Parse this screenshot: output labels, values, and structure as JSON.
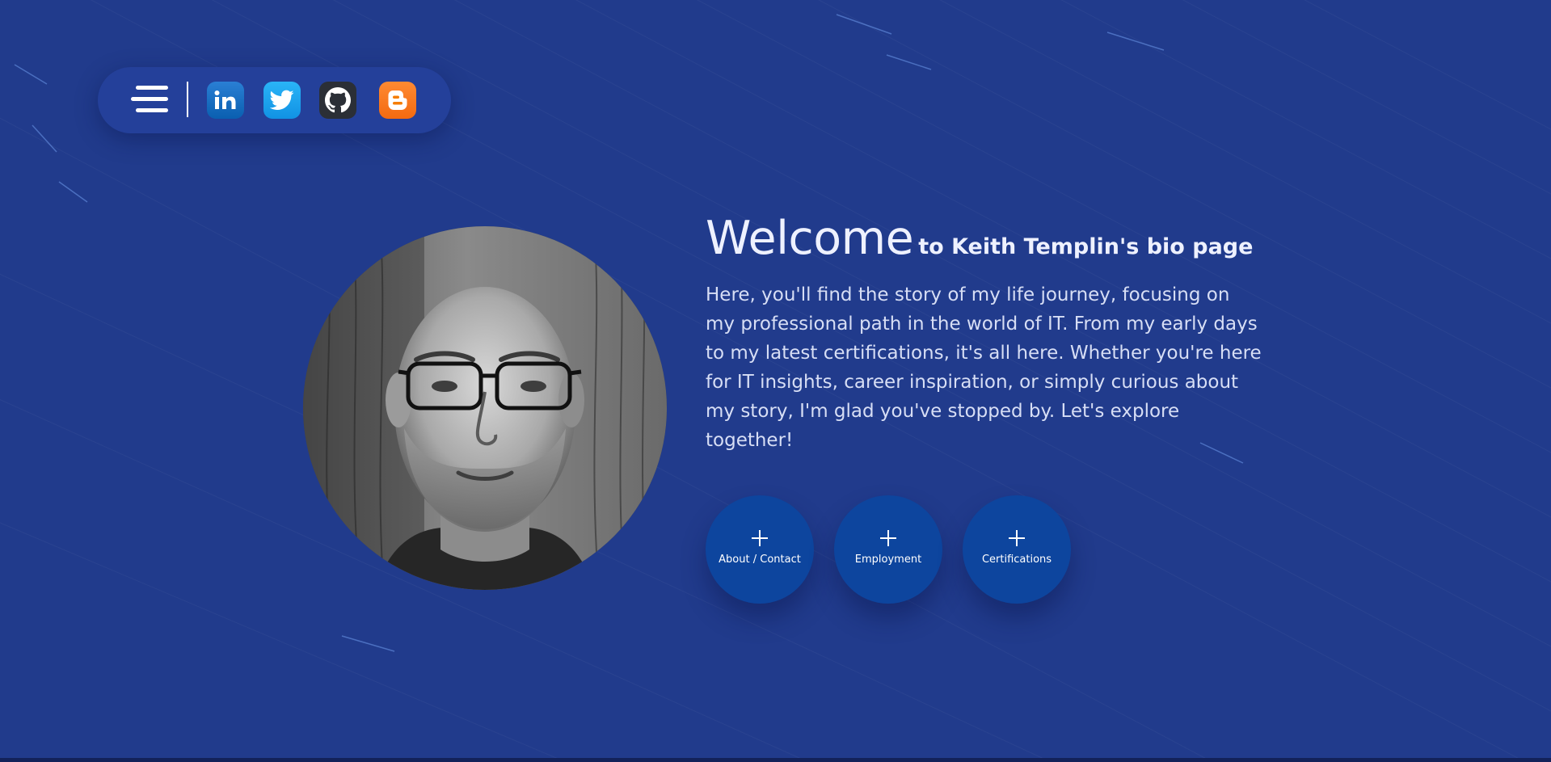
{
  "theme": {
    "background": "#213b8c",
    "nav_background": "#24409a",
    "button_background": "#0d459e",
    "text_color": "#eef1ff",
    "body_text_color": "#d7def5"
  },
  "nav": {
    "menu_icon": "hamburger-menu-icon",
    "social_links": [
      {
        "name": "LinkedIn",
        "icon": "linkedin-icon",
        "color": "#0a66c2"
      },
      {
        "name": "Twitter",
        "icon": "twitter-bird-icon",
        "color": "#1da1f2"
      },
      {
        "name": "GitHub",
        "icon": "github-octocat-icon",
        "color": "#2b2f36"
      },
      {
        "name": "Blogger",
        "icon": "blogger-icon",
        "color": "#f57d00"
      }
    ]
  },
  "portrait": {
    "alt": "Black and white portrait photo of Keith Templin"
  },
  "hero": {
    "title": "Welcome",
    "subtitle": "to Keith Templin's bio page",
    "intro": "Here, you'll find the story of my life journey, focusing on my professional path in the world of IT. From my early days to my latest certifications, it's all here. Whether you're here for IT insights, career inspiration, or simply curious about my story, I'm glad you've stopped by. Let's explore together!"
  },
  "buttons": [
    {
      "label": "About / Contact",
      "icon": "plus-icon"
    },
    {
      "label": "Employment",
      "icon": "plus-icon"
    },
    {
      "label": "Certifications",
      "icon": "plus-icon"
    }
  ]
}
